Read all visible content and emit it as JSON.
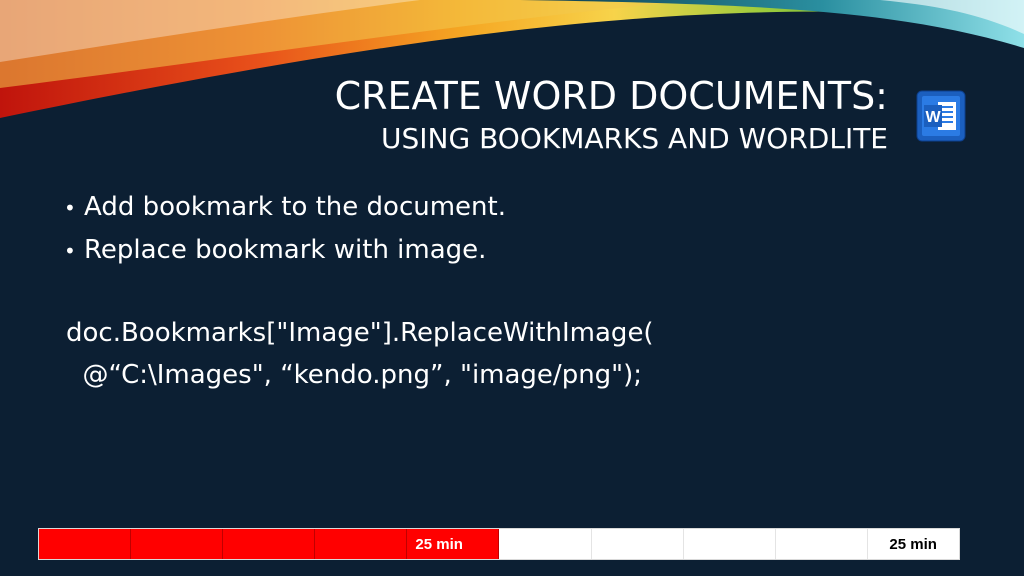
{
  "slide": {
    "title_main": "CREATE WORD DOCUMENTS:",
    "title_sub": "USING BOOKMARKS AND WORDLITE",
    "bullets": [
      "Add bookmark to the document.",
      "Replace bookmark with image."
    ],
    "code_lines": [
      "doc.Bookmarks[\"Image\"].ReplaceWithImage(",
      "  @“C:\\Images\", “kendo.png”, \"image/png\");"
    ],
    "logo_icon": "word-logo-icon",
    "logo_letter": "W"
  },
  "timer": {
    "elapsed_label": "25 min",
    "total_label": "25 min",
    "filled_segments": 5,
    "total_segments": 10,
    "fill_color": "#ff0000"
  },
  "colors": {
    "background": "#0c1f33",
    "text": "#ffffff",
    "word_blue": "#2b5797"
  }
}
